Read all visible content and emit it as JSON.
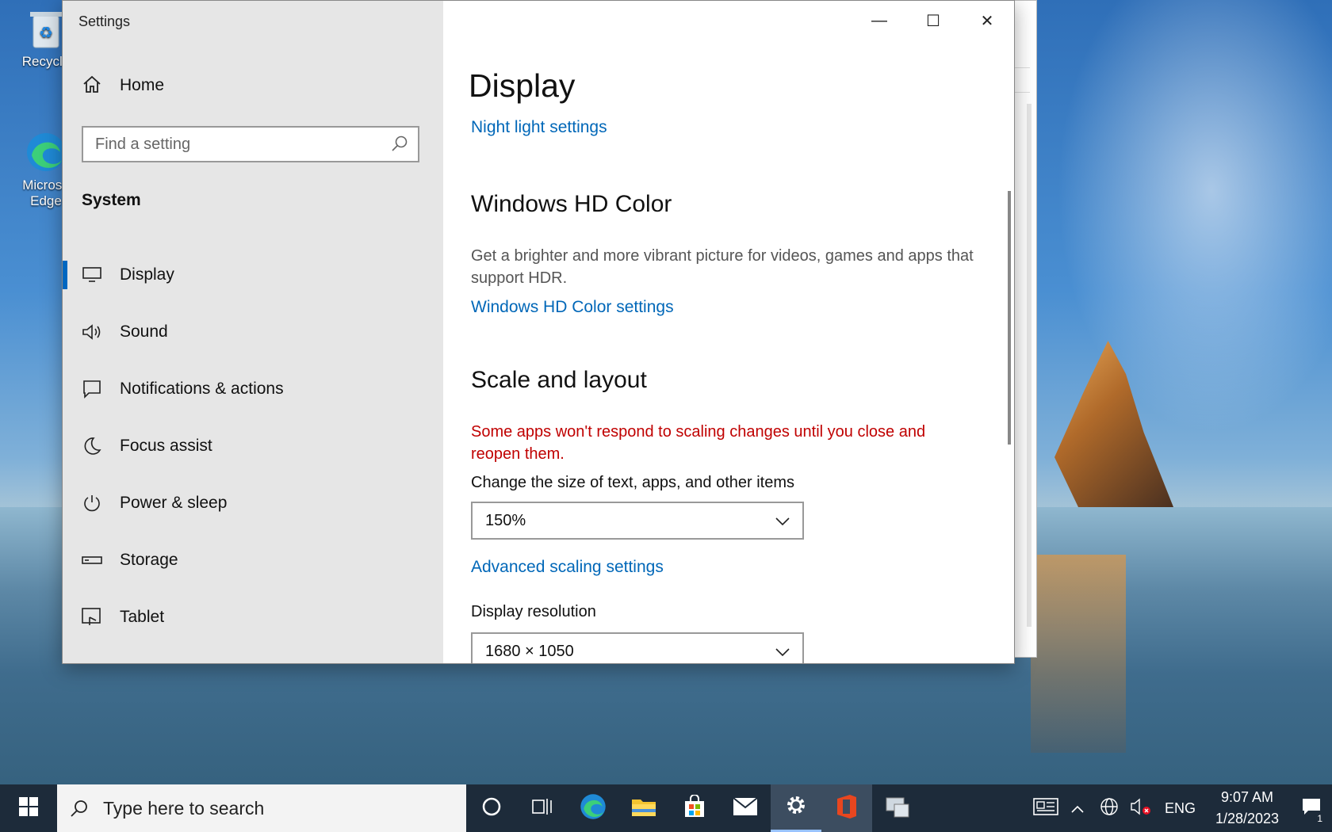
{
  "desktop": {
    "icons": [
      {
        "label": "Recycle"
      },
      {
        "label": "Microsoft Edge",
        "line1": "Microso",
        "line2": "Edge"
      }
    ]
  },
  "window": {
    "title": "Settings",
    "minimize_glyph": "—",
    "maximize_glyph": "☐",
    "close_glyph": "✕"
  },
  "sidebar": {
    "home_label": "Home",
    "search_placeholder": "Find a setting",
    "section_title": "System",
    "items": [
      {
        "label": "Display",
        "icon": "monitor-icon",
        "active": true
      },
      {
        "label": "Sound",
        "icon": "speaker-icon"
      },
      {
        "label": "Notifications & actions",
        "icon": "notification-icon"
      },
      {
        "label": "Focus assist",
        "icon": "moon-icon"
      },
      {
        "label": "Power & sleep",
        "icon": "power-icon"
      },
      {
        "label": "Storage",
        "icon": "storage-icon"
      },
      {
        "label": "Tablet",
        "icon": "tablet-icon"
      }
    ]
  },
  "content": {
    "page_title": "Display",
    "night_light_link": "Night light settings",
    "hd_color": {
      "heading": "Windows HD Color",
      "description": "Get a brighter and more vibrant picture for videos, games and apps that support HDR.",
      "link": "Windows HD Color settings"
    },
    "scale": {
      "heading": "Scale and layout",
      "warning": "Some apps won't respond to scaling changes until you close and reopen them.",
      "size_label": "Change the size of text, apps, and other items",
      "size_value": "150%",
      "advanced_link": "Advanced scaling settings",
      "resolution_label": "Display resolution",
      "resolution_value": "1680 × 1050"
    }
  },
  "taskbar": {
    "search_placeholder": "Type here to search",
    "language": "ENG",
    "time": "9:07 AM",
    "date": "1/28/2023",
    "notification_count": "1"
  },
  "colors": {
    "accent": "#0067c0",
    "link": "#0067b8",
    "warning": "#c00000",
    "taskbar": "#1d2b3a"
  }
}
